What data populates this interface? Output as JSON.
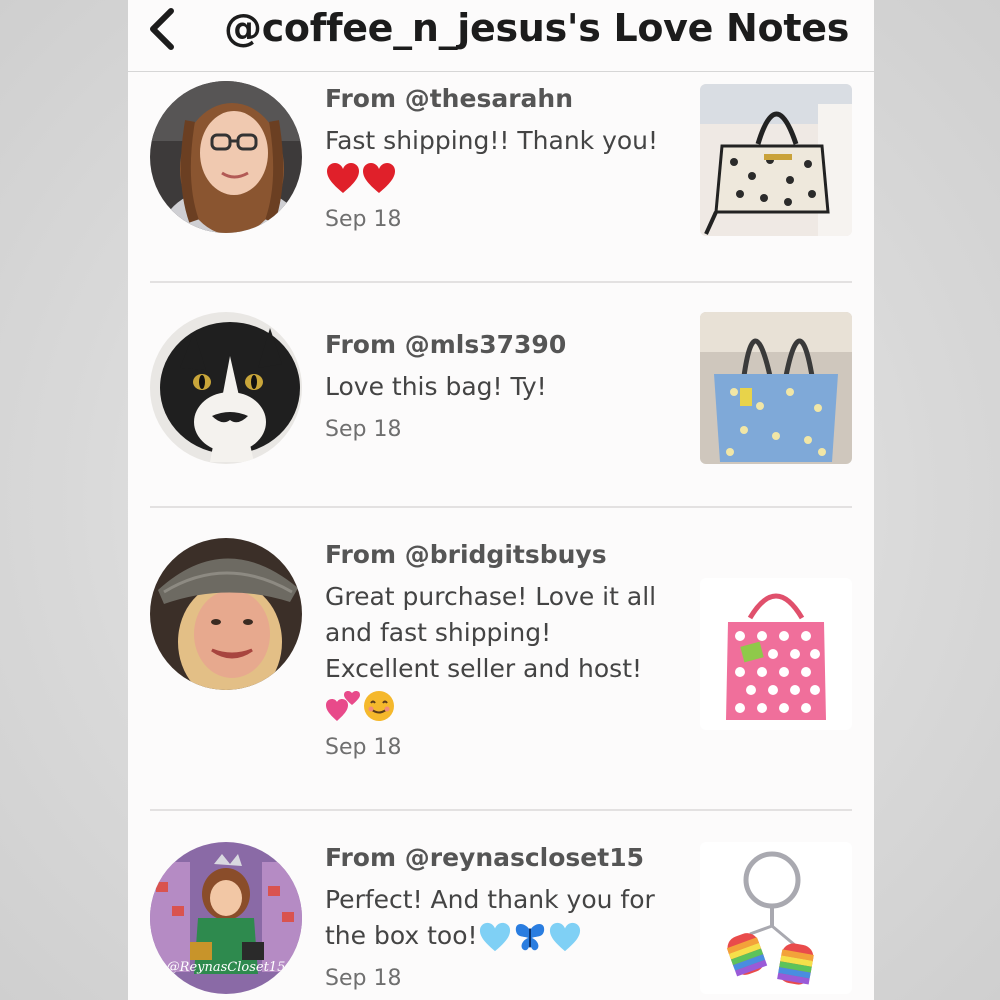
{
  "header": {
    "title": "@coffee_n_jesus's Love Notes"
  },
  "notes": [
    {
      "from": "From @thesarahn",
      "message": "Fast shipping!! Thank you!",
      "emojis": [
        "heart-icon",
        "heart-icon"
      ],
      "date": "Sep 18",
      "item": "leopard print handbag"
    },
    {
      "from": "From @mls37390",
      "message": "Love this bag! Ty!",
      "emojis": [],
      "date": "Sep 18",
      "item": "blue floral tote bag"
    },
    {
      "from": "From @bridgitsbuys",
      "message_lines": [
        "Great purchase! Love it all",
        "and fast shipping!",
        "Excellent seller and host!"
      ],
      "emojis": [
        "two-hearts-icon",
        "smiling-face-icon"
      ],
      "date": "Sep 18",
      "item": "pink polka dot tote"
    },
    {
      "from": "From @reynascloset15",
      "message_lines": [
        "Perfect! And thank you for",
        "the box too!"
      ],
      "emojis": [
        "blue-heart-icon",
        "butterfly-icon",
        "blue-heart-icon"
      ],
      "date": "Sep 18",
      "item": "rainbow mitten keychain",
      "avatar_caption": "@ReynasCloset15"
    }
  ],
  "colors": {
    "heart": "#e0202a",
    "pink": "#e84a8a",
    "blue_heart": "#7fd0f5",
    "butterfly": "#2a7de0",
    "smile": "#f5b82c"
  }
}
